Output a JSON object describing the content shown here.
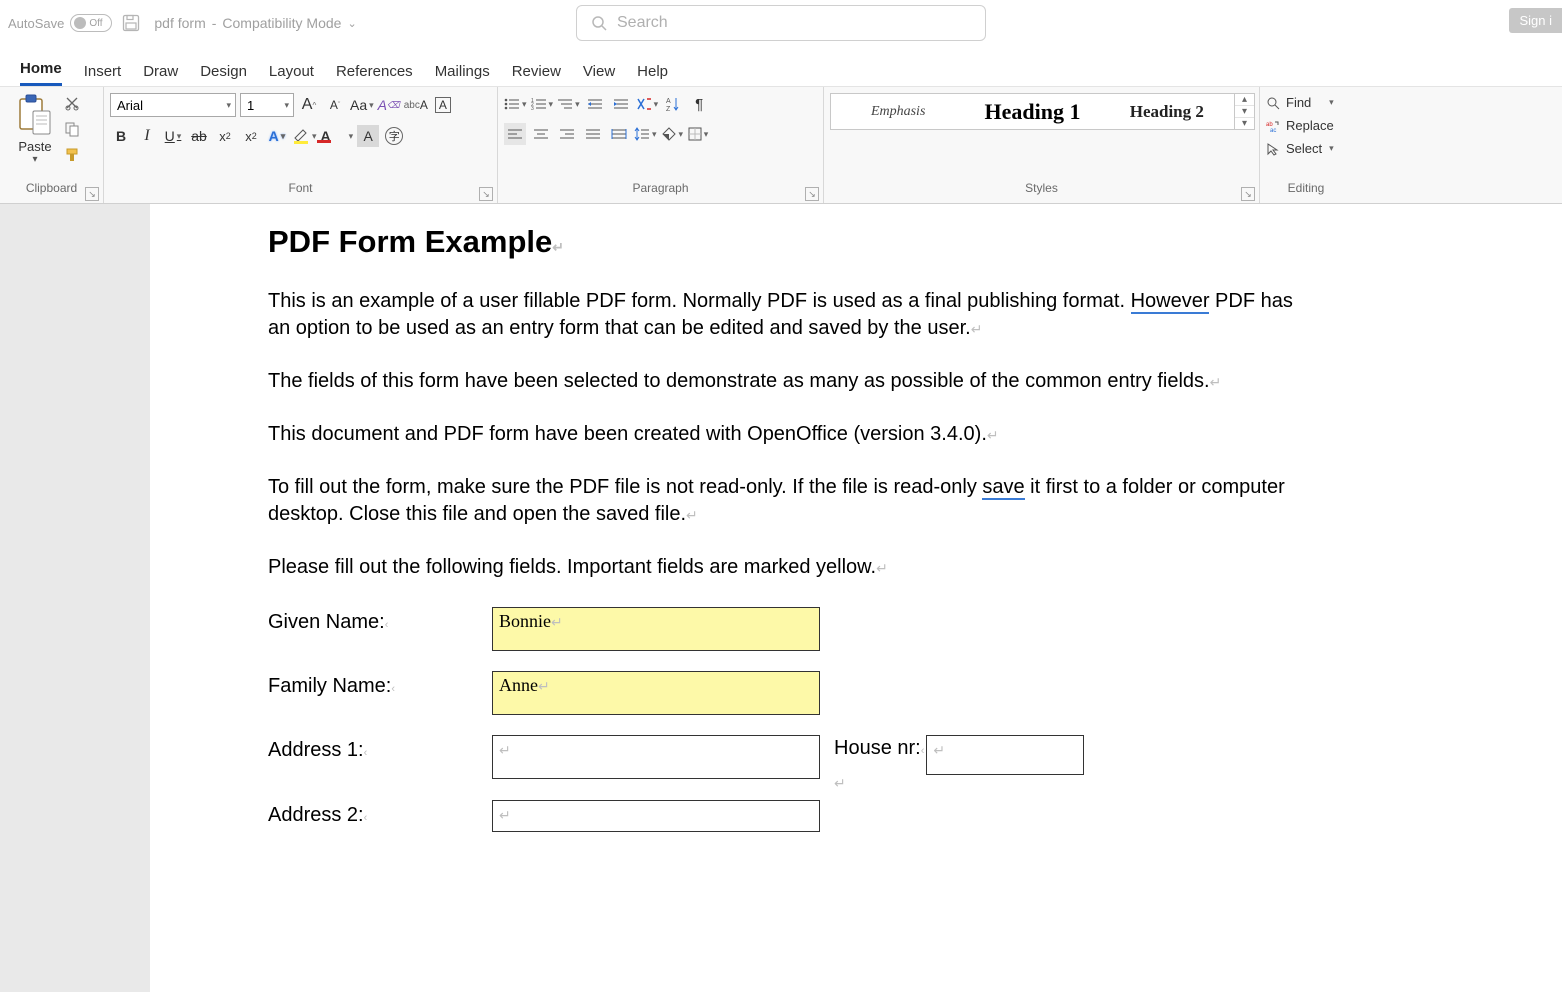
{
  "titlebar": {
    "autosave_label": "AutoSave",
    "autosave_state": "Off",
    "doc_name": "pdf form",
    "doc_mode": "Compatibility Mode",
    "search_placeholder": "Search",
    "signin": "Sign i"
  },
  "menu": {
    "items": [
      "Home",
      "Insert",
      "Draw",
      "Design",
      "Layout",
      "References",
      "Mailings",
      "Review",
      "View",
      "Help"
    ],
    "active": "Home"
  },
  "ribbon": {
    "clipboard": {
      "paste": "Paste",
      "label": "Clipboard"
    },
    "font": {
      "label": "Font",
      "name": "Arial",
      "size": "1"
    },
    "paragraph": {
      "label": "Paragraph"
    },
    "styles": {
      "label": "Styles",
      "cards": [
        {
          "text": "Emphasis",
          "italic": true,
          "size": "14px",
          "weight": "400",
          "color": "#444"
        },
        {
          "text": "Heading 1",
          "italic": false,
          "size": "22px",
          "weight": "800",
          "color": "#000"
        },
        {
          "text": "Heading 2",
          "italic": false,
          "size": "17px",
          "weight": "700",
          "color": "#222"
        }
      ]
    },
    "editing": {
      "label": "Editing",
      "find": "Find",
      "replace": "Replace",
      "select": "Select"
    }
  },
  "document": {
    "title": "PDF Form Example",
    "p1a": "This is an example of a user fillable PDF form. Normally PDF is used as a final publishing format. ",
    "p1_spell": "However",
    "p1b": " PDF has an option to be used as an entry form that can be edited and saved by the user.",
    "p2": "The fields of this form have been selected to demonstrate as many as possible of the common entry fields.",
    "p3": "This document and PDF form have been created with OpenOffice (version 3.4.0).",
    "p4a": "To fill out the form, make sure the PDF file is not read-only. If the file is read-only ",
    "p4_spell": "save",
    "p4b": " it first to a folder or computer desktop. Close this file and open the saved file.",
    "p5": "Please fill out the following fields. Important fields are marked yellow.",
    "form": {
      "given_name_label": "Given Name:",
      "given_name_value": "Bonnie",
      "family_name_label": "Family Name:",
      "family_name_value": "Anne",
      "address1_label": "Address 1:",
      "address1_value": "",
      "house_label": "House nr:",
      "house_value": "",
      "address2_label": "Address 2:",
      "address2_value": ""
    }
  }
}
